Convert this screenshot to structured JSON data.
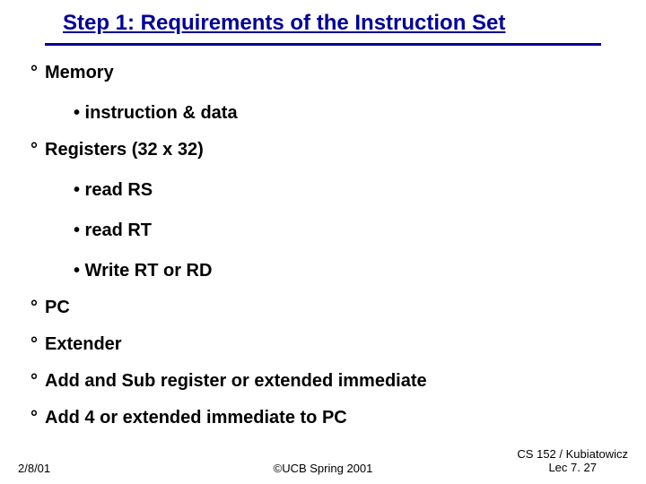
{
  "title": "Step 1: Requirements of the Instruction Set",
  "items": [
    {
      "text": "Memory",
      "type": "deg"
    },
    {
      "text": "• instruction & data",
      "type": "sub"
    },
    {
      "text": "Registers (32 x 32)",
      "type": "deg"
    },
    {
      "text": "• read RS",
      "type": "sub"
    },
    {
      "text": "• read RT",
      "type": "sub"
    },
    {
      "text": "• Write RT or RD",
      "type": "sub"
    },
    {
      "text": "PC",
      "type": "deg"
    },
    {
      "text": "Extender",
      "type": "deg"
    },
    {
      "text": "Add and Sub register or extended immediate",
      "type": "deg"
    },
    {
      "text": "Add 4 or extended immediate to PC",
      "type": "deg"
    }
  ],
  "footer": {
    "left": "2/8/01",
    "center": "©UCB Spring 2001",
    "right_line1": "CS 152 / Kubiatowicz",
    "right_line2": "Lec 7. 27"
  },
  "spacing": {
    "deg_mt": 18,
    "sub_mt": 22,
    "first_mt": 0
  }
}
